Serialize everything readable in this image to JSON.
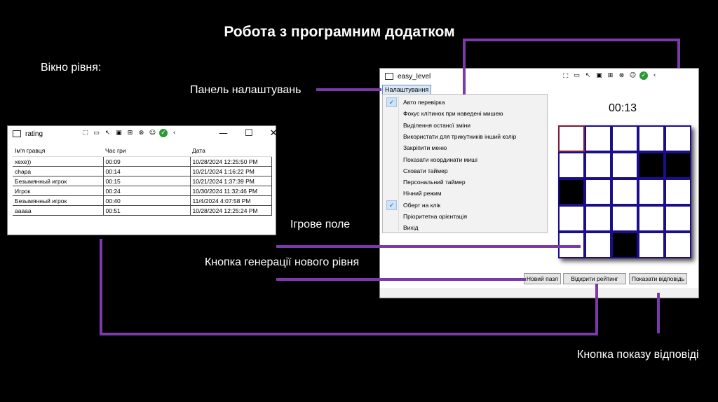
{
  "slide": {
    "title": "Робота з програмним додатком",
    "label_level_window": "Вікно рівня:",
    "label_settings_panel": "Панель налаштувань",
    "label_game_field": "Ігрове поле",
    "label_new_level_button": "Кнопка генерації нового рівня",
    "label_show_answer_button": "Кнопка показу відповіді",
    "accent_color": "#7a3aa8"
  },
  "rating_window": {
    "title": "rating",
    "columns": [
      "Ім'я гравця",
      "Час гри",
      "Дата"
    ],
    "rows": [
      [
        "хехе))",
        "00:09",
        "10/28/2024 12:25:50 PM"
      ],
      [
        "chapa",
        "00:14",
        "10/21/2024 1:16:22 PM"
      ],
      [
        "Безымянный игрок",
        "00:15",
        "10/21/2024 1:37:39 PM"
      ],
      [
        "Игрок",
        "00:24",
        "10/30/2024 11:32:46 PM"
      ],
      [
        "Безымянный игрок",
        "00:40",
        "11/4/2024 4:07:58 PM"
      ],
      [
        "ааааа",
        "00:51",
        "10/28/2024 12:25:24 PM"
      ]
    ],
    "controls": {
      "minimize": "—",
      "maximize": "☐",
      "close": "✕"
    }
  },
  "easy_window": {
    "title": "easy_level",
    "menu_label": "Налаштування",
    "menu_items": [
      {
        "label": "Авто перевірка",
        "checked": true
      },
      {
        "label": "Фокус клітинок при наведені мишею",
        "checked": false
      },
      {
        "label": "Виділення останої зміни",
        "checked": false
      },
      {
        "label": "Використати для трикутників інший колір",
        "checked": false
      },
      {
        "label": "Закріпити меню",
        "checked": false
      },
      {
        "label": "Показати координати миші",
        "checked": false
      },
      {
        "label": "Сховати таймер",
        "checked": false
      },
      {
        "label": "Персональний таймер",
        "checked": false
      },
      {
        "label": "Нічний режим",
        "checked": false
      },
      {
        "label": "Оберт на клік",
        "checked": true
      },
      {
        "label": "Пріоритетна орієнтація",
        "checked": false
      },
      {
        "label": "Вихід",
        "checked": false
      }
    ],
    "timer": "00:13",
    "board": [
      [
        0,
        0,
        0,
        0,
        0
      ],
      [
        0,
        0,
        0,
        1,
        1
      ],
      [
        1,
        0,
        0,
        0,
        0
      ],
      [
        0,
        0,
        0,
        0,
        0
      ],
      [
        0,
        0,
        1,
        0,
        0
      ]
    ],
    "buttons": {
      "new_puzzle": "Новий пазл",
      "open_rating": "Відкрити рейтинг",
      "show_answer": "Показати відповідь"
    }
  }
}
